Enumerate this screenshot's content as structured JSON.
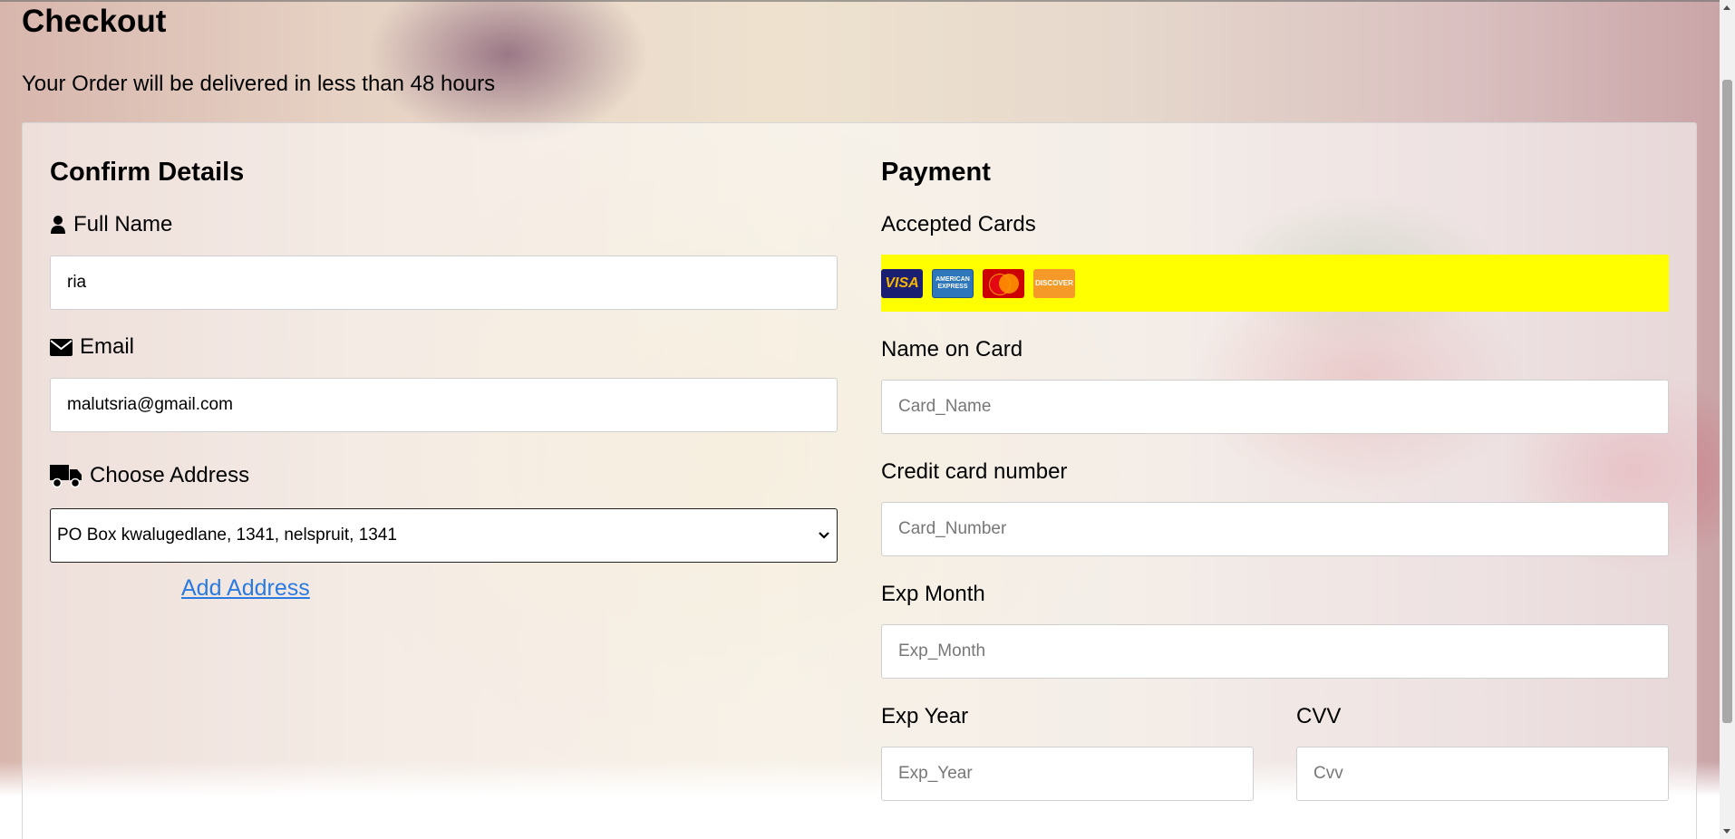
{
  "header": {
    "title": "Checkout",
    "subtitle": "Your Order will be delivered in less than 48 hours"
  },
  "confirm": {
    "heading": "Confirm Details",
    "full_name_label": "Full Name",
    "full_name_value": "ria",
    "email_label": "Email",
    "email_value": "malutsria@gmail.com",
    "address_label": "Choose Address",
    "address_selected": "PO Box kwalugedlane, 1341, nelspruit, 1341",
    "add_address_link": "Add Address"
  },
  "payment": {
    "heading": "Payment",
    "accepted_cards_label": "Accepted Cards",
    "cards": [
      {
        "name": "VISA",
        "icon": "visa-card-icon",
        "color": "#1a1f71"
      },
      {
        "name": "AMERICAN EXPRESS",
        "icon": "amex-card-icon",
        "color": "#2e77bb"
      },
      {
        "name": "mastercard",
        "icon": "mastercard-icon",
        "color": "#cc0000"
      },
      {
        "name": "DISCOVER",
        "icon": "discover-card-icon",
        "color": "#f59a28"
      }
    ],
    "cards_strip_color": "#ffff00",
    "name_on_card_label": "Name on Card",
    "name_on_card_placeholder": "Card_Name",
    "card_number_label": "Credit card number",
    "card_number_placeholder": "Card_Number",
    "exp_month_label": "Exp Month",
    "exp_month_placeholder": "Exp_Month",
    "exp_year_label": "Exp Year",
    "exp_year_placeholder": "Exp_Year",
    "cvv_label": "CVV",
    "cvv_placeholder": "Cvv"
  },
  "colors": {
    "link": "#2a7ae2",
    "text": "#000000"
  }
}
